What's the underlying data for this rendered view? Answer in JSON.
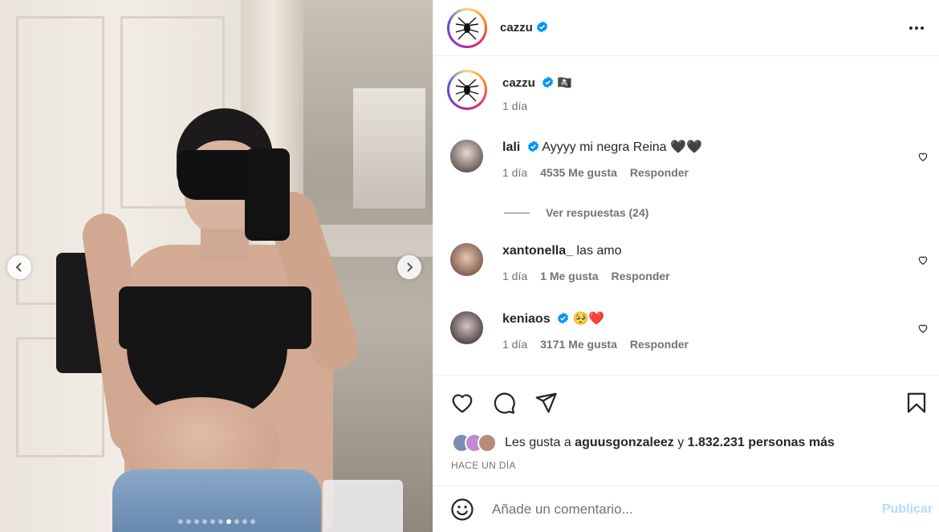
{
  "colors": {
    "accent": "#0095f6",
    "verified": "#0095f6",
    "muted": "#737373",
    "publish_disabled": "#b3dbff"
  },
  "carousel": {
    "total_slides": 10,
    "active_index": 6
  },
  "header": {
    "username": "cazzu",
    "more_icon": "ellipsis-icon"
  },
  "caption": {
    "username": "cazzu",
    "emoji": "🏴‍☠️",
    "time": "1 día"
  },
  "comments": [
    {
      "username": "lali",
      "verified": true,
      "text": "Ayyyy mi negra Reina 🖤🖤",
      "time": "1 día",
      "likes": "4535 Me gusta",
      "reply": "Responder"
    },
    {
      "username": "xantonella_",
      "verified": false,
      "text": "las amo",
      "time": "1 día",
      "likes": "1 Me gusta",
      "reply": "Responder"
    },
    {
      "username": "keniaos",
      "verified": true,
      "text": "🥺❤️",
      "time": "1 día",
      "likes": "3171 Me gusta",
      "reply": "Responder"
    }
  ],
  "view_replies": "Ver respuestas (24)",
  "likes": {
    "prefix": "Les gusta a ",
    "user": "aguusgonzaleez",
    "middle": " y ",
    "count": "1.832.231 personas más"
  },
  "posted_ago": "HACE UN DÍA",
  "add_comment": {
    "placeholder": "Añade un comentario...",
    "publish": "Publicar"
  }
}
